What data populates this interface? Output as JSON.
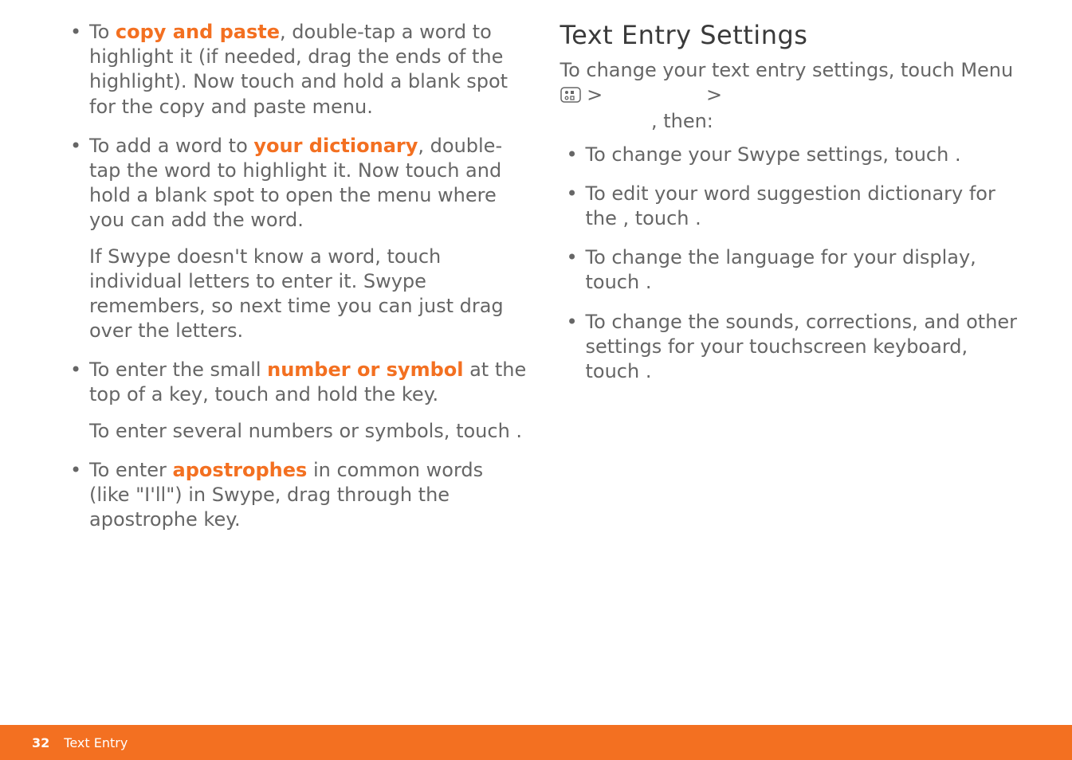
{
  "left": {
    "items": [
      {
        "pre": "To ",
        "hl": "copy and paste",
        "post": ", double-tap a word to highlight it (if needed, drag the ends of the highlight). Now touch and hold a blank spot for the copy and paste menu."
      },
      {
        "pre": "To add a word to ",
        "hl": "your dictionary",
        "post": ", double-tap the word to highlight it. Now touch and hold a blank spot to open the menu where you can add the word.",
        "follow": "If Swype doesn't know a word, touch individual letters to enter it. Swype remembers, so next time you can just drag over the letters."
      },
      {
        "pre": "To enter the small ",
        "hl": "number or symbol",
        "post": " at the top of a key, touch and hold the key.",
        "follow": "To enter several numbers or symbols, touch        ."
      },
      {
        "pre": "To enter ",
        "hl": "apostrophes",
        "post": " in common words (like \"I'll\") in Swype, drag through the apostrophe key."
      }
    ]
  },
  "right": {
    "heading": "Text Entry Settings",
    "lead_a": "To change your text entry settings, touch Menu ",
    "lead_b": " > ",
    "lead_c": " > ",
    "lead_d": ", then:",
    "items": [
      "To change your Swype settings, touch           .",
      "To edit your word suggestion dictionary for the                                         , touch                               .",
      "To change the language for your display, touch                          .",
      "To change the sounds, corrections, and other settings for your touchscreen keyboard, touch                             ."
    ]
  },
  "footer": {
    "page": "32",
    "section": "Text Entry"
  }
}
